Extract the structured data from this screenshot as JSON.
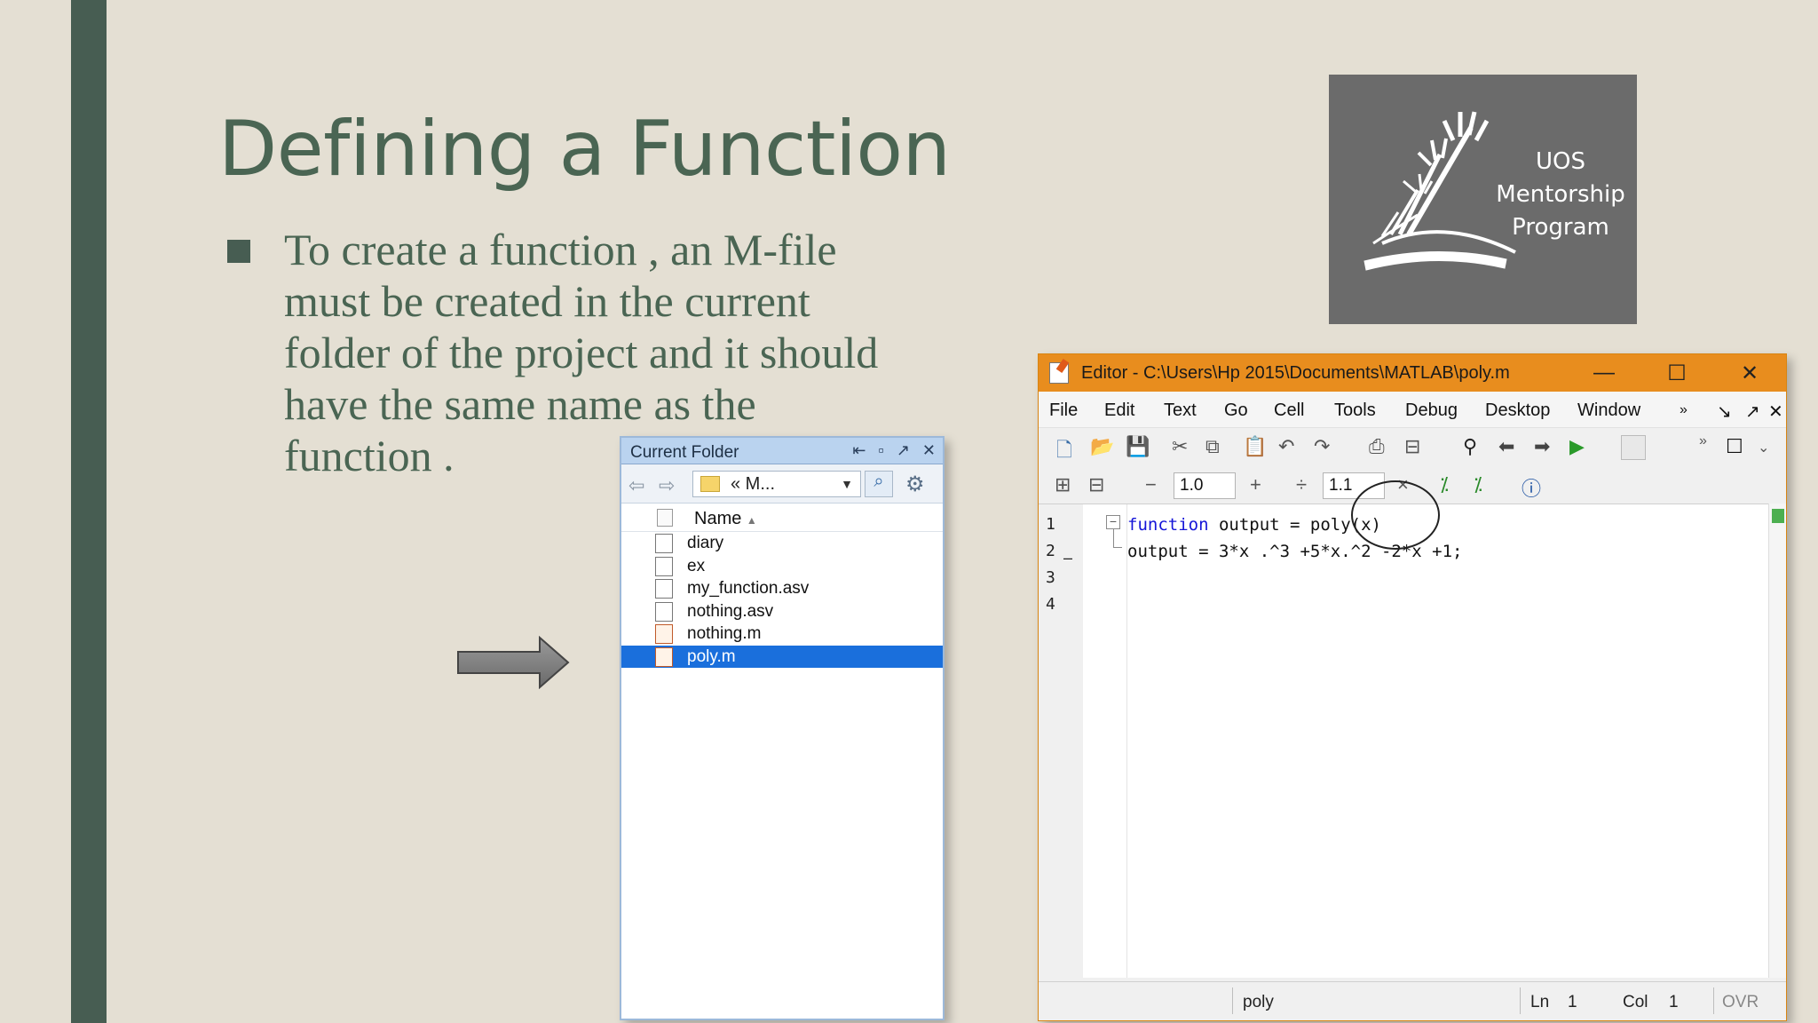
{
  "slide": {
    "title": "Defining a Function",
    "bullet": "To create a function , an M-file must be created in the current folder of the project and it should have the same name as the function ."
  },
  "logo": {
    "lines": [
      "UOS",
      "Mentorship",
      "Program"
    ]
  },
  "current_folder": {
    "title": "Current Folder",
    "path": "« M...",
    "column_name": "Name",
    "files": [
      {
        "name": "diary",
        "type": "file"
      },
      {
        "name": "ex",
        "type": "file"
      },
      {
        "name": "my_function.asv",
        "type": "file"
      },
      {
        "name": "nothing.asv",
        "type": "file"
      },
      {
        "name": "nothing.m",
        "type": "m-file"
      },
      {
        "name": "poly.m",
        "type": "m-file",
        "selected": true
      }
    ]
  },
  "editor": {
    "title": "Editor - C:\\Users\\Hp 2015\\Documents\\MATLAB\\poly.m",
    "menu": [
      "File",
      "Edit",
      "Text",
      "Go",
      "Cell",
      "Tools",
      "Debug",
      "Desktop",
      "Window",
      "»"
    ],
    "cell_toolbar": {
      "minus": "−",
      "value1": "1.0",
      "plus": "+",
      "divide": "÷",
      "value2": "1.1",
      "times": "×"
    },
    "line_numbers": [
      "1",
      "2",
      "3",
      "4"
    ],
    "code": [
      {
        "keyword": "function",
        "rest": " output = poly(x)"
      },
      {
        "keyword": "",
        "rest": "output = 3*x .^3 +5*x.^2 -2*x +1;"
      }
    ],
    "status": {
      "function": "poly",
      "ln_label": "Ln",
      "ln": "1",
      "col_label": "Col",
      "col": "1",
      "mode": "OVR"
    }
  },
  "colors": {
    "background": "#e4dfd3",
    "accent": "#475d52",
    "title": "#4a6553",
    "editor_titlebar": "#e88d1e",
    "selection": "#1a6fdc"
  }
}
